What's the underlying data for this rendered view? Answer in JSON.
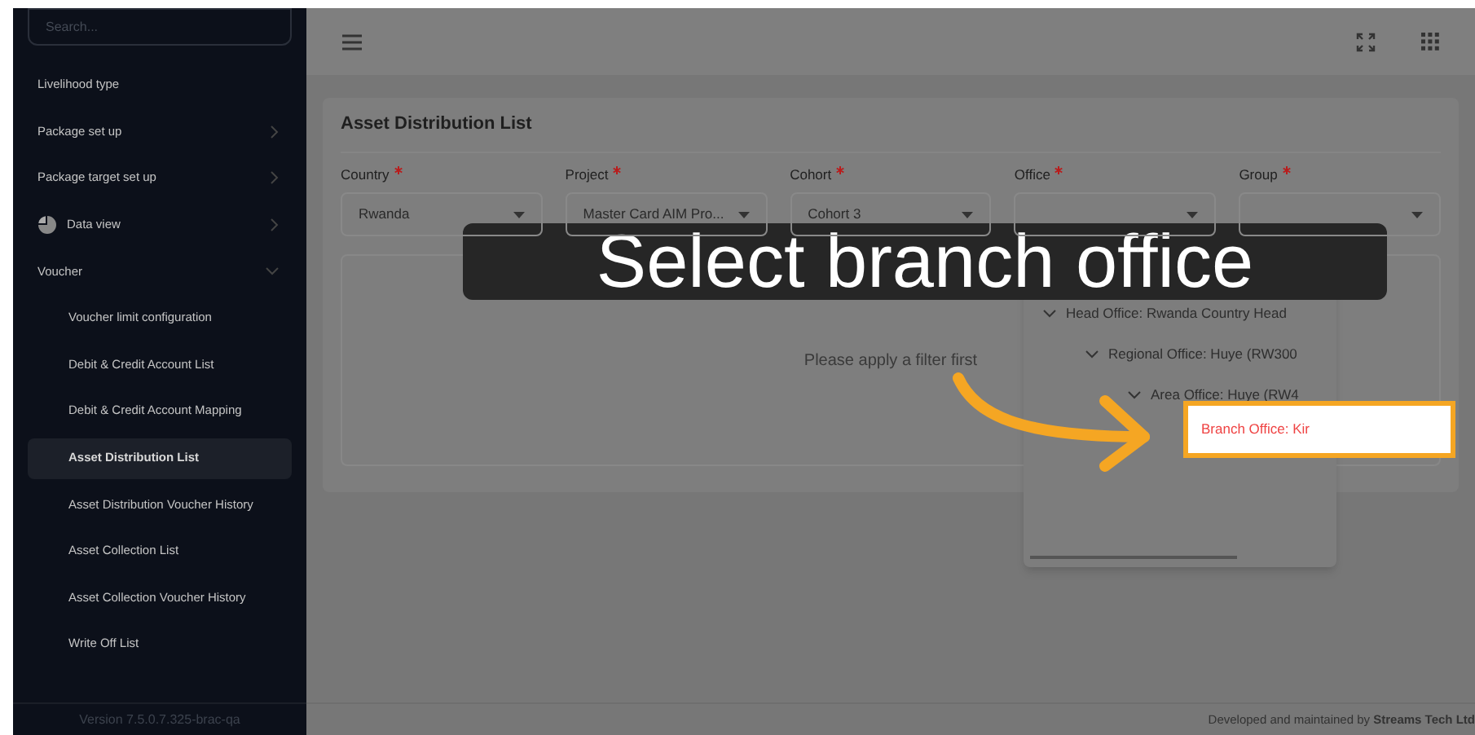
{
  "sidebar": {
    "search": {
      "placeholder": "Search..."
    },
    "items": [
      {
        "kind": "link",
        "label": "Livelihood type",
        "selected": false
      },
      {
        "kind": "group",
        "label": "Package set up",
        "expanded": false,
        "selected": false
      },
      {
        "kind": "group",
        "label": "Package target set up",
        "expanded": false,
        "selected": false
      },
      {
        "kind": "chart_group",
        "label": "Data view",
        "expanded": false,
        "selected": false
      },
      {
        "kind": "group",
        "label": "Voucher",
        "expanded": true,
        "selected": false
      },
      {
        "kind": "sub",
        "label": "Voucher limit configuration",
        "selected": false
      },
      {
        "kind": "sub",
        "label": "Debit & Credit Account List",
        "selected": false
      },
      {
        "kind": "sub",
        "label": "Debit & Credit Account Mapping",
        "selected": false
      },
      {
        "kind": "sub",
        "label": "Asset Distribution List",
        "selected": true
      },
      {
        "kind": "sub",
        "label": "Asset Distribution Voucher History",
        "selected": false
      },
      {
        "kind": "sub",
        "label": "Asset Collection List",
        "selected": false
      },
      {
        "kind": "sub",
        "label": "Asset Collection Voucher History",
        "selected": false
      },
      {
        "kind": "sub",
        "label": "Write Off List",
        "selected": false
      }
    ],
    "version": "Version 7.5.0.7.325-brac-qa"
  },
  "page": {
    "title": "Asset Distribution List",
    "filters": [
      {
        "label": "Country",
        "required": true,
        "value": "Rwanda"
      },
      {
        "label": "Project",
        "required": true,
        "value": "Master Card AIM Pro..."
      },
      {
        "label": "Cohort",
        "required": true,
        "value": "Cohort 3"
      },
      {
        "label": "Office",
        "required": true
      },
      {
        "label": "Group",
        "required": true
      }
    ],
    "empty_message": "Please apply a filter first"
  },
  "office_tree": [
    {
      "label": "Head Office: Rwanda Country Head",
      "expanded": true,
      "highlighted": false,
      "children": [
        {
          "label": "Regional Office: Huye (RW300",
          "expanded": true,
          "highlighted": false,
          "children": [
            {
              "label": "Area Office: Huye (RW4",
              "expanded": true,
              "highlighted": false,
              "children": [
                {
                  "label": "Branch Office: Kir",
                  "highlighted": true
                }
              ]
            }
          ]
        }
      ]
    }
  ],
  "footer": "Developed and maintained by **Streams Tech Ltd**",
  "caption": "Select branch office"
}
